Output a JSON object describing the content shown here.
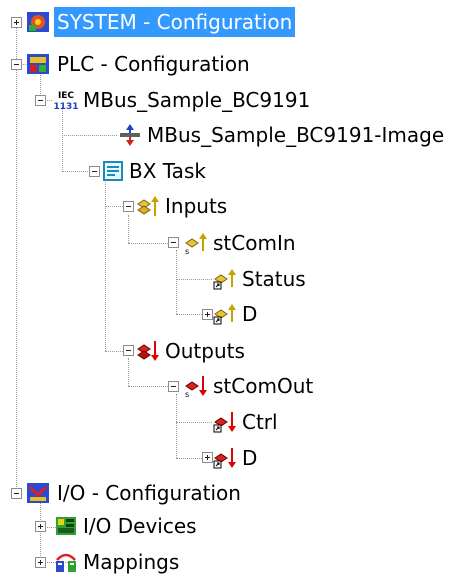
{
  "tree": {
    "system": {
      "label": "SYSTEM - Configuration",
      "icon": "system-config-icon",
      "selected": true,
      "expander": "plus"
    },
    "plc": {
      "label": "PLC - Configuration",
      "icon": "plc-config-icon",
      "expander": "minus",
      "project": {
        "label": "MBus_Sample_BC9191",
        "icon": "iec-1131-icon",
        "expander": "minus",
        "image": {
          "label": "MBus_Sample_BC9191-Image",
          "icon": "process-image-icon"
        },
        "task": {
          "label": "BX Task",
          "icon": "task-icon",
          "expander": "minus",
          "inputs": {
            "label": "Inputs",
            "icon": "inputs-icon",
            "expander": "minus",
            "struct": {
              "label": "stComIn",
              "icon": "input-struct-icon",
              "expander": "minus",
              "children": [
                {
                  "label": "Status",
                  "icon": "input-variable-icon"
                },
                {
                  "label": "D",
                  "icon": "input-variable-icon",
                  "expander": "plus"
                }
              ]
            }
          },
          "outputs": {
            "label": "Outputs",
            "icon": "outputs-icon",
            "expander": "minus",
            "struct": {
              "label": "stComOut",
              "icon": "output-struct-icon",
              "expander": "minus",
              "children": [
                {
                  "label": "Ctrl",
                  "icon": "output-variable-icon"
                },
                {
                  "label": "D",
                  "icon": "output-variable-icon",
                  "expander": "plus"
                }
              ]
            }
          }
        }
      }
    },
    "io": {
      "label": "I/O - Configuration",
      "icon": "io-config-icon",
      "expander": "minus",
      "children": [
        {
          "label": "I/O Devices",
          "icon": "io-devices-icon",
          "expander": "plus"
        },
        {
          "label": "Mappings",
          "icon": "mappings-icon",
          "expander": "plus"
        }
      ]
    }
  },
  "colors": {
    "selection": "#3399ff",
    "input_arrow": "#c8a000",
    "output_arrow": "#e00000"
  }
}
